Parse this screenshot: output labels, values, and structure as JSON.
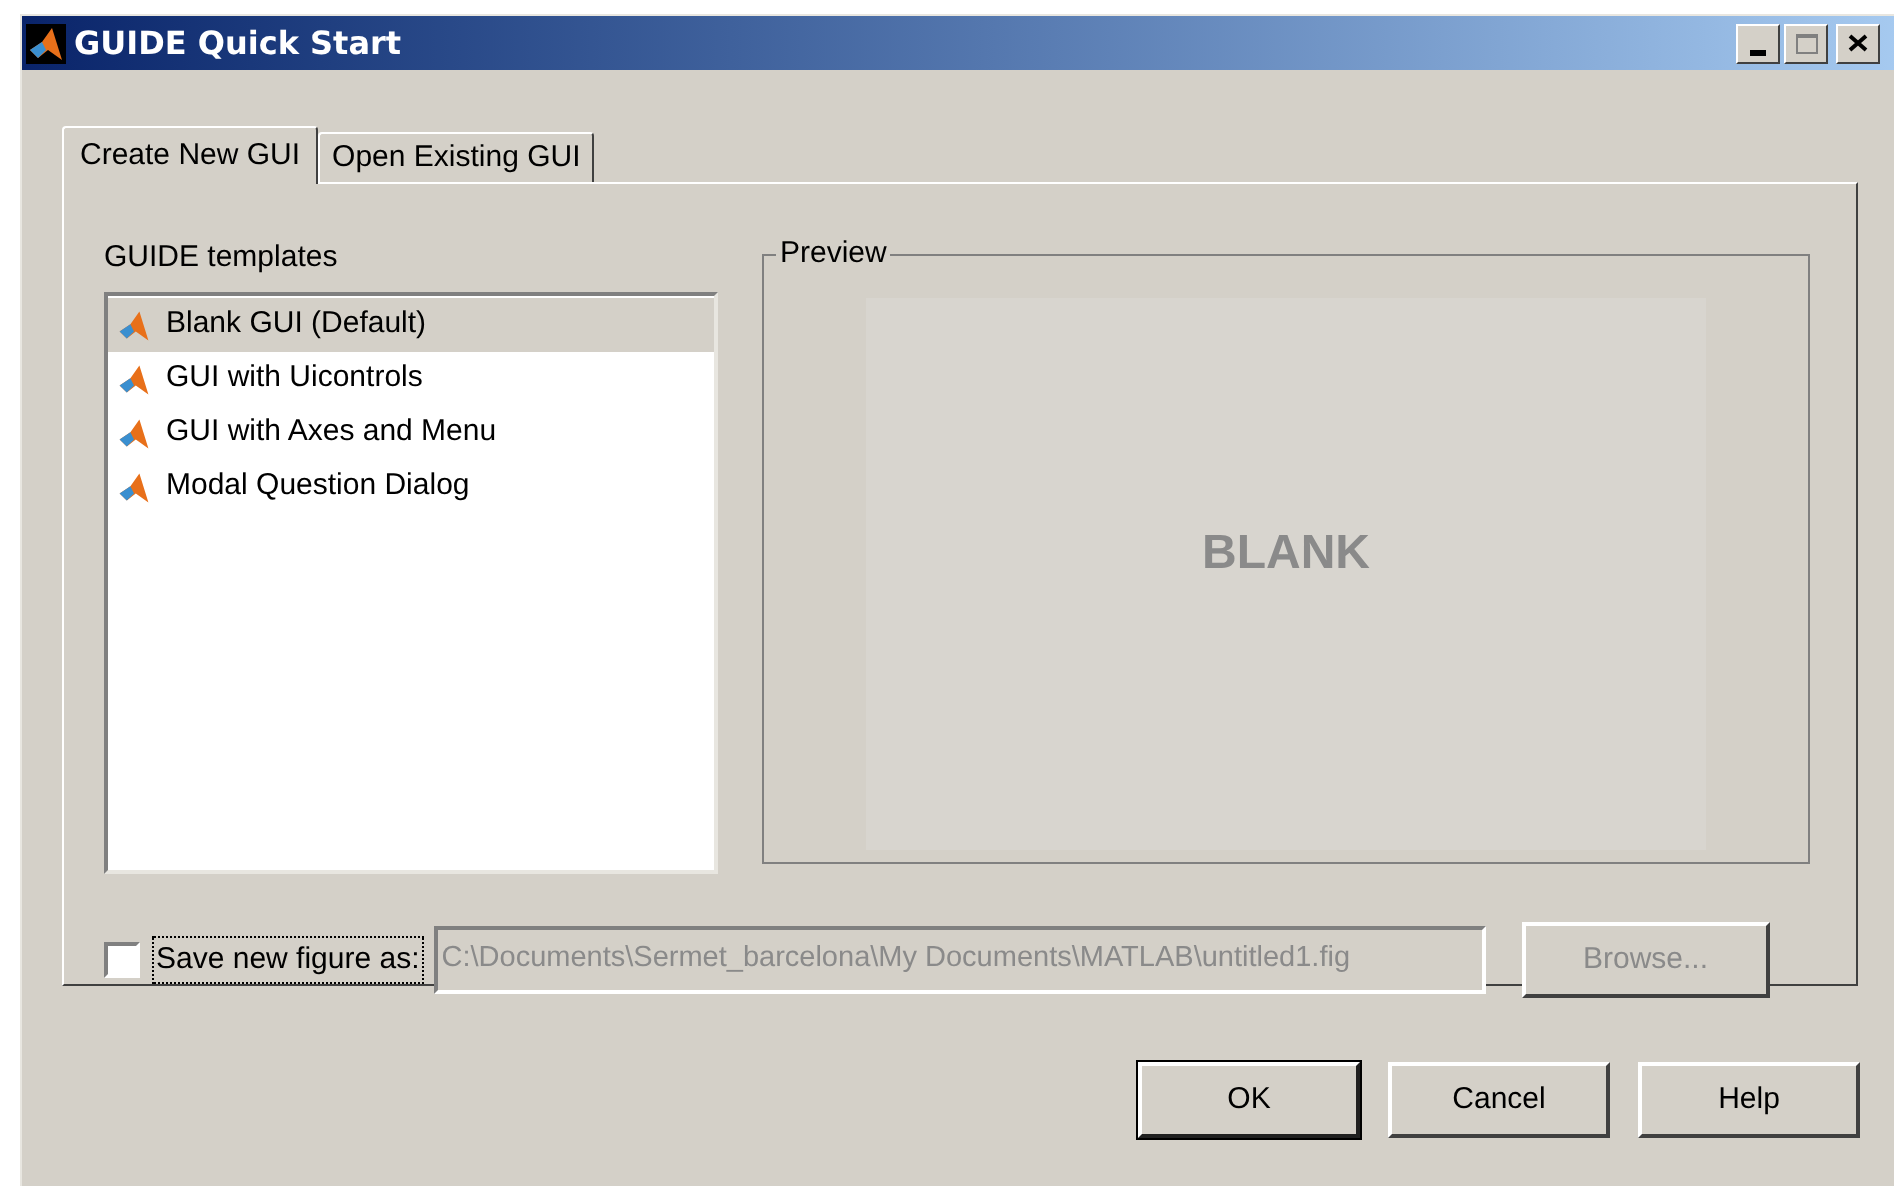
{
  "window": {
    "title": "GUIDE Quick Start"
  },
  "tabs": [
    {
      "label": "Create New GUI",
      "selected": true
    },
    {
      "label": "Open Existing GUI",
      "selected": false
    }
  ],
  "templates": {
    "label": "GUIDE templates",
    "items": [
      {
        "label": "Blank GUI (Default)",
        "selected": true
      },
      {
        "label": "GUI with Uicontrols",
        "selected": false
      },
      {
        "label": "GUI with Axes and Menu",
        "selected": false
      },
      {
        "label": "Modal Question Dialog",
        "selected": false
      }
    ]
  },
  "preview": {
    "label": "Preview",
    "text": "BLANK"
  },
  "save": {
    "label": "Save new figure as:",
    "checked": false,
    "value": "C:\\Documents\\Sermet_barcelona\\My Documents\\MATLAB\\untitled1.fig",
    "disabled": true
  },
  "browse": {
    "label": "Browse...",
    "disabled": true
  },
  "buttons": [
    "OK",
    "Cancel",
    "Help"
  ]
}
